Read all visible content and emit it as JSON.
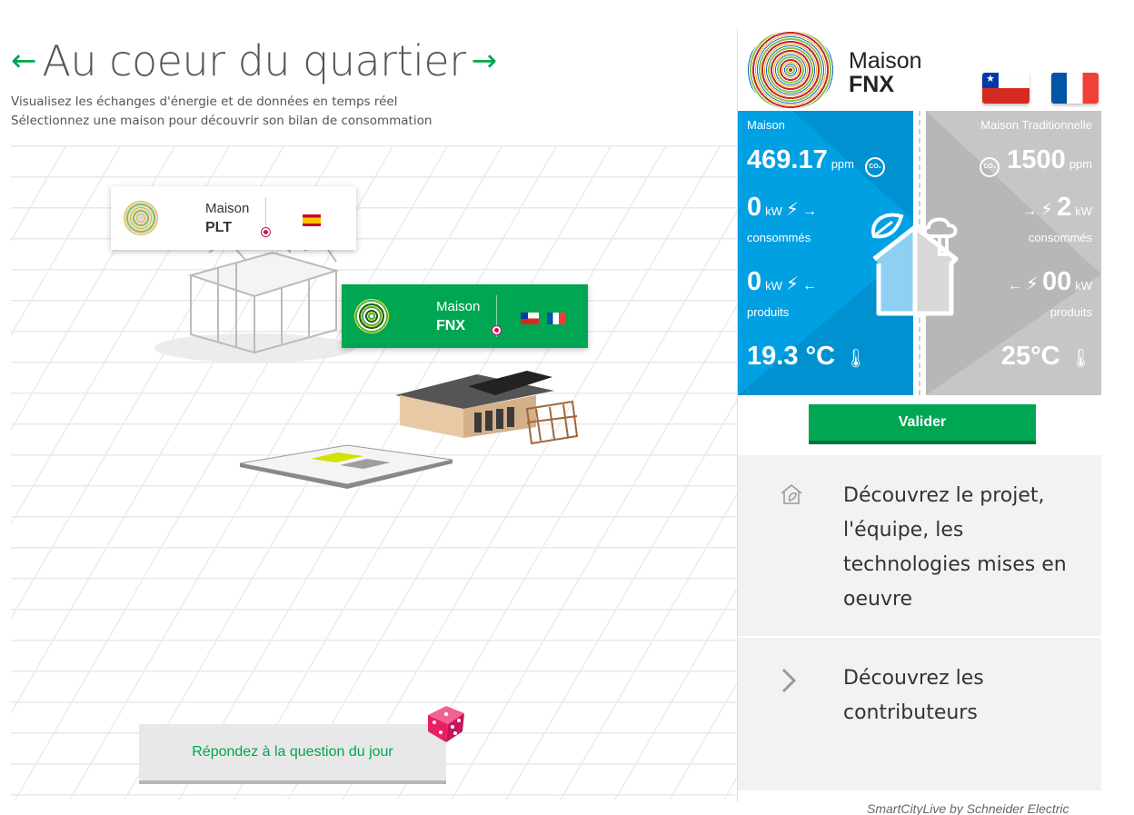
{
  "header": {
    "title": "Au coeur du quartier",
    "subtitle_line1": "Visualisez les échanges d'énergie et de données en temps réel",
    "subtitle_line2": "Sélectionnez une maison pour découvrir son bilan de consommation"
  },
  "map": {
    "house_plt": {
      "label": "Maison",
      "name": "PLT",
      "flags": [
        "spain-flag"
      ]
    },
    "house_fnx": {
      "label": "Maison",
      "name": "FNX",
      "flags": [
        "chile-flag",
        "france-flag"
      ]
    }
  },
  "question_button": "Répondez à la question du jour",
  "panel": {
    "house_label": "Maison",
    "house_name": "FNX",
    "flags": [
      "chile-flag",
      "france-flag"
    ],
    "maison": {
      "label": "Maison",
      "co2_value": "469.17",
      "co2_unit": "ppm",
      "consumed_value": "0",
      "consumed_unit": "kW",
      "consumed_label": "consommés",
      "produced_value": "0",
      "produced_unit": "kW",
      "produced_label": "produits",
      "temperature": "19.3 °C"
    },
    "traditionnelle": {
      "label": "Maison Traditionnelle",
      "co2_value": "1500",
      "co2_unit": "ppm",
      "consumed_value": "2",
      "consumed_unit": "kW",
      "consumed_label": "consommés",
      "produced_value": "00",
      "produced_unit": "kW",
      "produced_label": "produits",
      "temperature": "25°C"
    },
    "co2_badge": "CO₂",
    "validate_button": "Valider",
    "link_project": [
      "Découvrez le projet,",
      "l'équipe, les",
      "technologies mises en",
      "oeuvre"
    ],
    "link_contributors": [
      "Découvrez les",
      "contributeurs"
    ]
  },
  "footer": "SmartCityLive by Schneider Electric",
  "colors": {
    "accent_green": "#00a651",
    "blue": "#00a0e3",
    "grey": "#c6c6c6",
    "pink": "#c2185b"
  }
}
